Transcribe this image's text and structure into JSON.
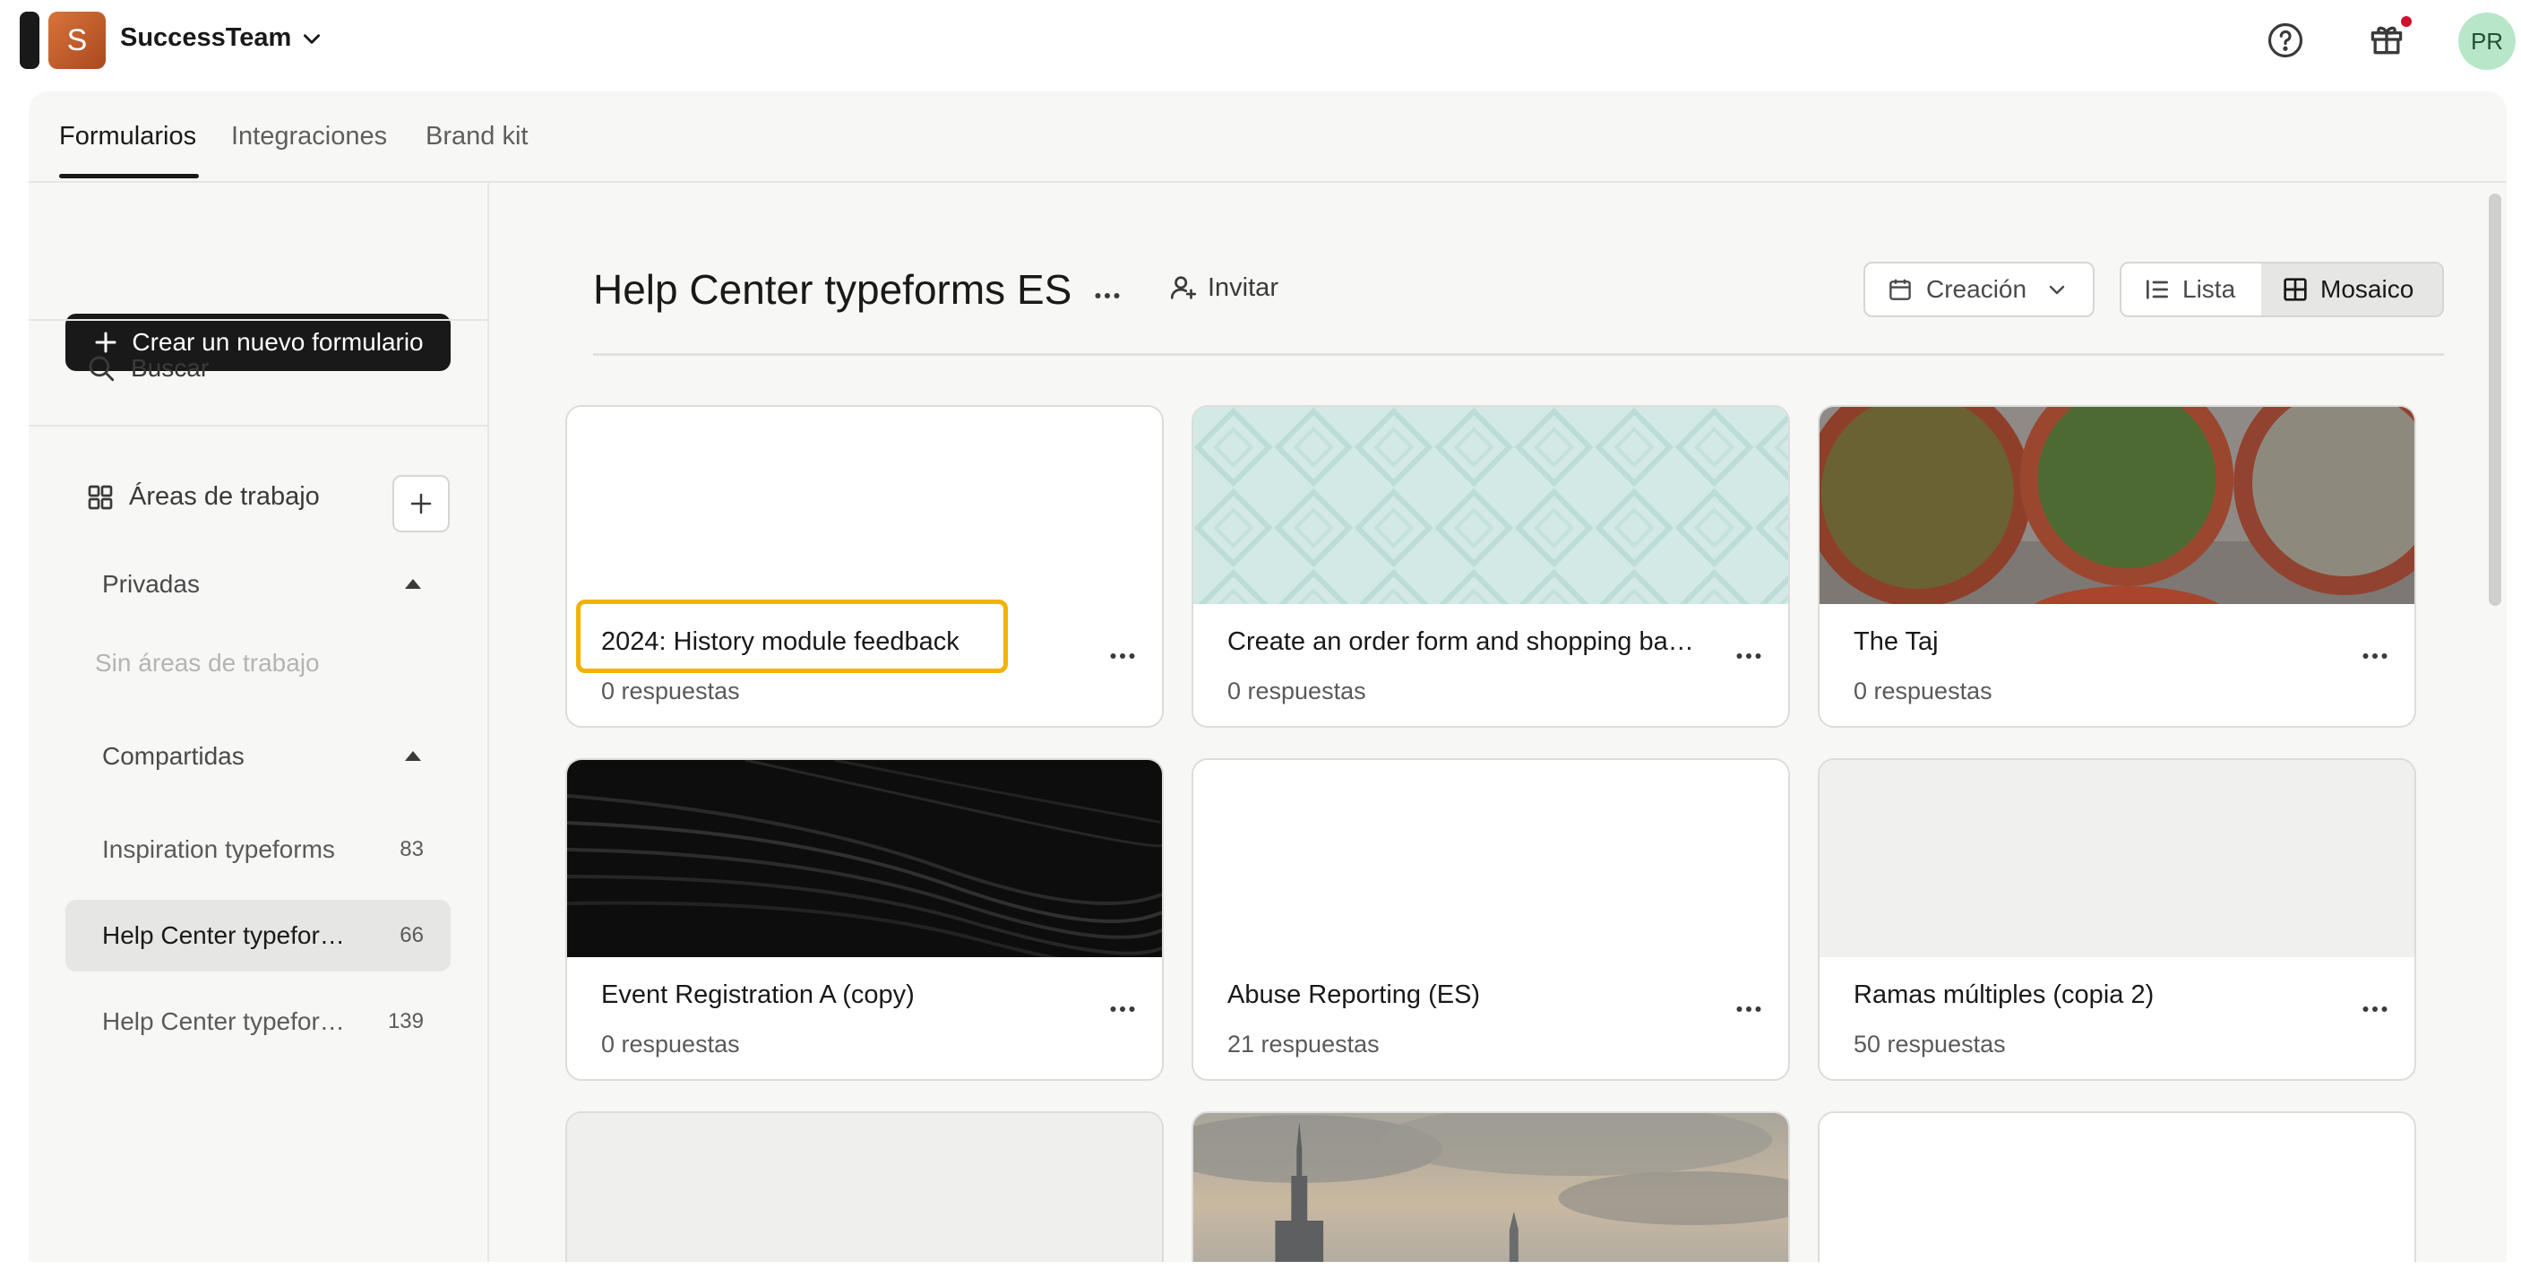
{
  "topbar": {
    "logo_letter": "S",
    "team_name": "SuccessTeam",
    "avatar_initials": "PR",
    "colors": {
      "logo": "#c15a27",
      "avatar_bg": "#b8e6c9",
      "notification_dot": "#d10f2f"
    },
    "icons": [
      "chevron-down-icon",
      "help-icon",
      "gift-icon"
    ]
  },
  "tabs": [
    {
      "label": "Formularios",
      "active": true
    },
    {
      "label": "Integraciones",
      "active": false
    },
    {
      "label": "Brand kit",
      "active": false
    }
  ],
  "sidebar": {
    "create_label": "Crear un nuevo formulario",
    "search_label": "Buscar",
    "workspaces_label": "Áreas de trabajo",
    "private": {
      "label": "Privadas",
      "empty": "Sin áreas de trabajo"
    },
    "shared": {
      "label": "Compartidas",
      "items": [
        {
          "label": "Inspiration typeforms",
          "count": "83",
          "selected": false
        },
        {
          "label": "Help Center typeforms ES",
          "count": "66",
          "selected": true
        },
        {
          "label": "Help Center typeforms EN",
          "count": "139",
          "selected": false
        }
      ]
    }
  },
  "main": {
    "title": "Help Center typeforms ES",
    "invite_label": "Invitar",
    "sort_label": "Creación",
    "view": {
      "list_label": "Lista",
      "grid_label": "Mosaico",
      "selected": "Mosaico"
    },
    "cards": [
      {
        "title": "2024: History module feedback",
        "responses": "0 respuestas",
        "thumb": "blank",
        "highlighted": true
      },
      {
        "title": "Create an order form and shopping basket",
        "responses": "0 respuestas",
        "thumb": "teal-pattern"
      },
      {
        "title": "The Taj",
        "responses": "0 respuestas",
        "thumb": "spices-photo"
      },
      {
        "title": "Event Registration A (copy)",
        "responses": "0 respuestas",
        "thumb": "dark-waves"
      },
      {
        "title": "Abuse Reporting (ES)",
        "responses": "21 respuestas",
        "thumb": "blank"
      },
      {
        "title": "Ramas múltiples (copia 2)",
        "responses": "50 respuestas",
        "thumb": "light-gray"
      },
      {
        "title": "",
        "responses": "",
        "thumb": "light-gray"
      },
      {
        "title": "",
        "responses": "",
        "thumb": "city-skyline-photo"
      },
      {
        "title": "",
        "responses": "",
        "thumb": "blank"
      }
    ],
    "highlight_color": "#f2b300"
  }
}
